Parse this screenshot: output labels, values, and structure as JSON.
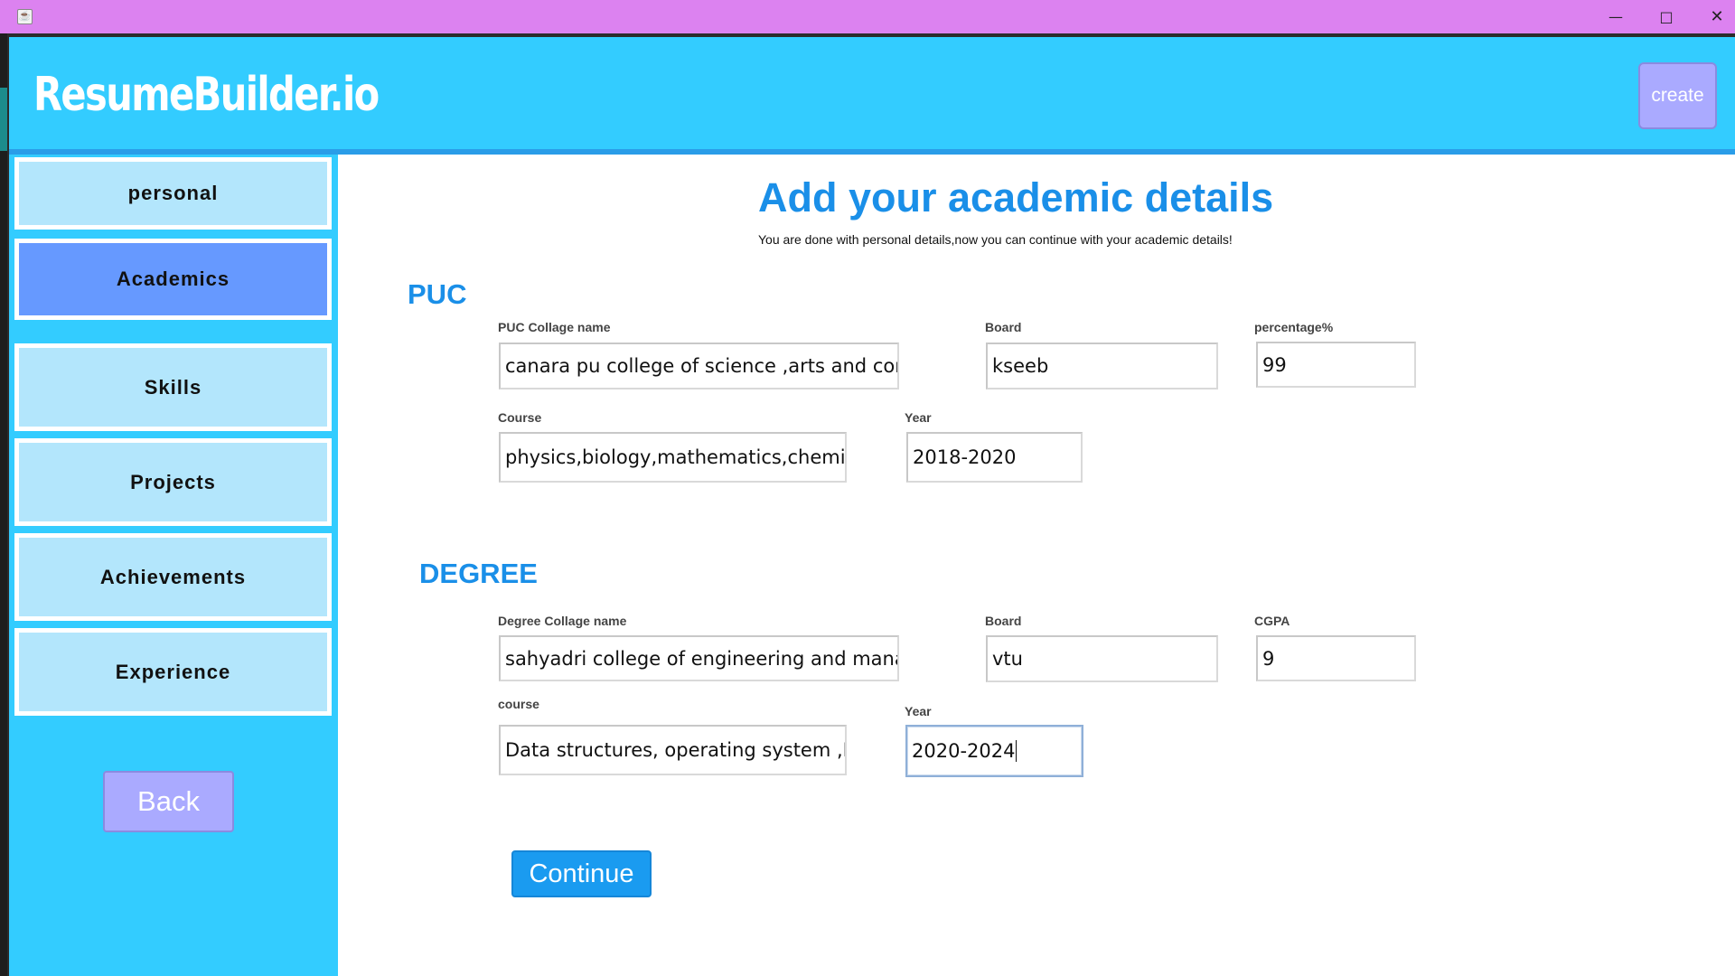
{
  "window": {
    "minimize_glyph": "—",
    "maximize_glyph": "□",
    "close_glyph": "✕",
    "title_bar_color": "#dc82f0"
  },
  "header": {
    "brand": "ResumeBuilder.io",
    "create_label": "create",
    "color": "#33ccff"
  },
  "sidebar": {
    "items": [
      {
        "label": "personal",
        "active": false
      },
      {
        "label": "Academics",
        "active": true
      },
      {
        "label": "Skills",
        "active": false
      },
      {
        "label": "Projects",
        "active": false
      },
      {
        "label": "Achievements",
        "active": false
      },
      {
        "label": "Experience",
        "active": false
      }
    ],
    "back_label": "Back",
    "active_color": "#6699ff",
    "item_color": "#b3e6fc"
  },
  "main": {
    "title": "Add your academic details",
    "subtitle": "You are done with personal details,now you can continue with your academic details!",
    "puc": {
      "heading": "PUC",
      "college_label": "PUC Collage name",
      "college_value": "canara pu college of science ,arts and com",
      "board_label": "Board",
      "board_value": "kseeb",
      "percentage_label": "percentage%",
      "percentage_value": "99",
      "course_label": "Course",
      "course_value": "physics,biology,mathematics,chemis",
      "year_label": "Year",
      "year_value": "2018-2020"
    },
    "degree": {
      "heading": "DEGREE",
      "college_label": "Degree Collage name",
      "college_value": "sahyadri college of engineering and mana",
      "board_label": "Board",
      "board_value": "vtu",
      "cgpa_label": "CGPA",
      "cgpa_value": "9",
      "course_label": "course",
      "course_value": "Data structures, operating system ,D",
      "year_label": "Year",
      "year_value": "2020-2024"
    },
    "continue_label": "Continue",
    "accent_color": "#1a8fe8"
  }
}
